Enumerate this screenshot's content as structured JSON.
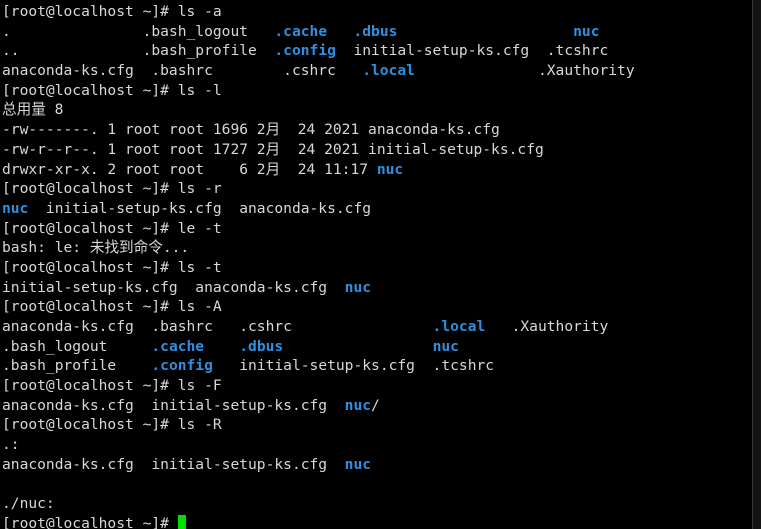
{
  "terminal": {
    "background_color": "#000000",
    "foreground_color": "#d8d8d8",
    "directory_color": "#2f8fe0",
    "cursor_color": "#00e000",
    "prompt": "[root@localhost ~]# ",
    "columns": 89,
    "rows": 27
  },
  "lines": [
    {
      "id": "line-01",
      "kind": "prompt",
      "prompt": "[root@localhost ~]# ",
      "command": "ls -a"
    },
    {
      "id": "line-02",
      "kind": "output",
      "segments": [
        {
          "text": ".               ",
          "color": "default"
        },
        {
          "text": ".bash_logout   ",
          "color": "default"
        },
        {
          "text": ".cache",
          "color": "dir"
        },
        {
          "text": "   ",
          "color": "default"
        },
        {
          "text": ".dbus",
          "color": "dir"
        },
        {
          "text": "                    ",
          "color": "default"
        },
        {
          "text": "nuc",
          "color": "dir"
        }
      ]
    },
    {
      "id": "line-03",
      "kind": "output",
      "segments": [
        {
          "text": "..              ",
          "color": "default"
        },
        {
          "text": ".bash_profile  ",
          "color": "default"
        },
        {
          "text": ".config",
          "color": "dir"
        },
        {
          "text": "  initial-setup-ks.cfg  .tcshrc",
          "color": "default"
        }
      ]
    },
    {
      "id": "line-04",
      "kind": "output",
      "segments": [
        {
          "text": "anaconda-ks.cfg  .bashrc        .cshrc   ",
          "color": "default"
        },
        {
          "text": ".local",
          "color": "dir"
        },
        {
          "text": "              .Xauthority",
          "color": "default"
        }
      ]
    },
    {
      "id": "line-05",
      "kind": "prompt",
      "prompt": "[root@localhost ~]# ",
      "command": "ls -l"
    },
    {
      "id": "line-06",
      "kind": "output",
      "segments": [
        {
          "text": "总用量 8",
          "color": "default"
        }
      ]
    },
    {
      "id": "line-07",
      "kind": "output",
      "segments": [
        {
          "text": "-rw-------. 1 root root 1696 2月  24 2021 anaconda-ks.cfg",
          "color": "default"
        }
      ]
    },
    {
      "id": "line-08",
      "kind": "output",
      "segments": [
        {
          "text": "-rw-r--r--. 1 root root 1727 2月  24 2021 initial-setup-ks.cfg",
          "color": "default"
        }
      ]
    },
    {
      "id": "line-09",
      "kind": "output",
      "segments": [
        {
          "text": "drwxr-xr-x. 2 root root    6 2月  24 11:17 ",
          "color": "default"
        },
        {
          "text": "nuc",
          "color": "dir"
        }
      ]
    },
    {
      "id": "line-10",
      "kind": "prompt",
      "prompt": "[root@localhost ~]# ",
      "command": "ls -r"
    },
    {
      "id": "line-11",
      "kind": "output",
      "segments": [
        {
          "text": "nuc",
          "color": "dir"
        },
        {
          "text": "  initial-setup-ks.cfg  anaconda-ks.cfg",
          "color": "default"
        }
      ]
    },
    {
      "id": "line-12",
      "kind": "prompt",
      "prompt": "[root@localhost ~]# ",
      "command": "le -t"
    },
    {
      "id": "line-13",
      "kind": "output",
      "segments": [
        {
          "text": "bash: le: 未找到命令...",
          "color": "default"
        }
      ]
    },
    {
      "id": "line-14",
      "kind": "prompt",
      "prompt": "[root@localhost ~]# ",
      "command": "ls -t"
    },
    {
      "id": "line-15",
      "kind": "output",
      "segments": [
        {
          "text": "initial-setup-ks.cfg  anaconda-ks.cfg  ",
          "color": "default"
        },
        {
          "text": "nuc",
          "color": "dir"
        }
      ]
    },
    {
      "id": "line-16",
      "kind": "prompt",
      "prompt": "[root@localhost ~]# ",
      "command": "ls -A"
    },
    {
      "id": "line-17",
      "kind": "output",
      "segments": [
        {
          "text": "anaconda-ks.cfg  .bashrc   .cshrc                ",
          "color": "default"
        },
        {
          "text": ".local",
          "color": "dir"
        },
        {
          "text": "   .Xauthority",
          "color": "default"
        }
      ]
    },
    {
      "id": "line-18",
      "kind": "output",
      "segments": [
        {
          "text": ".bash_logout     ",
          "color": "default"
        },
        {
          "text": ".cache",
          "color": "dir"
        },
        {
          "text": "    ",
          "color": "default"
        },
        {
          "text": ".dbus",
          "color": "dir"
        },
        {
          "text": "                 ",
          "color": "default"
        },
        {
          "text": "nuc",
          "color": "dir"
        }
      ]
    },
    {
      "id": "line-19",
      "kind": "output",
      "segments": [
        {
          "text": ".bash_profile    ",
          "color": "default"
        },
        {
          "text": ".config",
          "color": "dir"
        },
        {
          "text": "   initial-setup-ks.cfg  .tcshrc",
          "color": "default"
        }
      ]
    },
    {
      "id": "line-20",
      "kind": "prompt",
      "prompt": "[root@localhost ~]# ",
      "command": "ls -F"
    },
    {
      "id": "line-21",
      "kind": "output",
      "segments": [
        {
          "text": "anaconda-ks.cfg  initial-setup-ks.cfg  ",
          "color": "default"
        },
        {
          "text": "nuc",
          "color": "dir"
        },
        {
          "text": "/",
          "color": "default"
        }
      ]
    },
    {
      "id": "line-22",
      "kind": "prompt",
      "prompt": "[root@localhost ~]# ",
      "command": "ls -R"
    },
    {
      "id": "line-23",
      "kind": "output",
      "segments": [
        {
          "text": ".:",
          "color": "default"
        }
      ]
    },
    {
      "id": "line-24",
      "kind": "output",
      "segments": [
        {
          "text": "anaconda-ks.cfg  initial-setup-ks.cfg  ",
          "color": "default"
        },
        {
          "text": "nuc",
          "color": "dir"
        }
      ]
    },
    {
      "id": "line-25",
      "kind": "output",
      "segments": [
        {
          "text": "",
          "color": "default"
        }
      ]
    },
    {
      "id": "line-26",
      "kind": "output",
      "segments": [
        {
          "text": "./nuc:",
          "color": "default"
        }
      ]
    },
    {
      "id": "line-27",
      "kind": "prompt-cursor",
      "prompt": "[root@localhost ~]# ",
      "command": ""
    }
  ]
}
